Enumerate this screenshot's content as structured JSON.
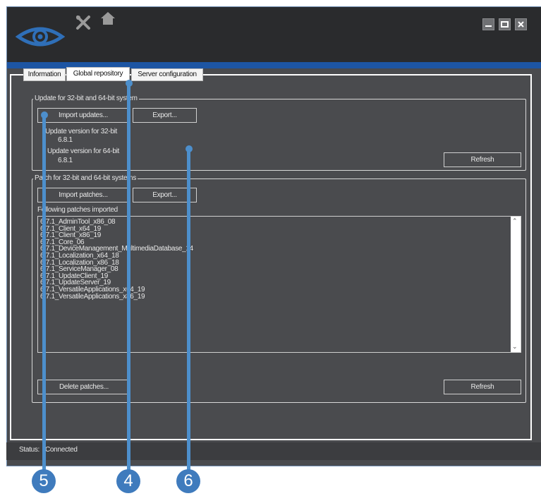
{
  "colors": {
    "accent": "#1d55a3",
    "callout": "#3f7bbd",
    "window_bg": "#4a4b4e",
    "titlebar": "#2a2b2d"
  },
  "titlebar": {
    "icons": [
      "eye-logo-icon",
      "tools-icon",
      "home-icon"
    ],
    "controls": [
      "minimize-icon",
      "maximize-icon",
      "close-icon"
    ]
  },
  "tabs": [
    {
      "label": "Information",
      "active": false
    },
    {
      "label": "Global repository",
      "active": true
    },
    {
      "label": "Server configuration",
      "active": false
    }
  ],
  "update_group": {
    "title": "Update for 32-bit and 64-bit system",
    "import_label": "Import updates...",
    "export_label": "Export...",
    "version32_label": "Update version for 32-bit",
    "version32_value": "6.8.1",
    "version64_label": "Update version for 64-bit",
    "version64_value": "6.8.1",
    "refresh_label": "Refresh"
  },
  "patch_group": {
    "title": "Patch for 32-bit and 64-bit systems",
    "import_label": "Import patches...",
    "export_label": "Export...",
    "list_label": "Following patches imported",
    "patches": [
      "6.7.1_AdminTool_x86_08",
      "6.7.1_Client_x64_19",
      "6.7.1_Client_x86_19",
      "6.7.1_Core_06",
      "6.7.1_DeviceManagement_MultimediaDatabase_14",
      "6.7.1_Localization_x64_18",
      "6.7.1_Localization_x86_18",
      "6.7.1_ServiceManager_08",
      "6.7.1_UpdateClient_19",
      "6.7.1_UpdateServer_19",
      "6.7.1_VersatileApplications_x64_19",
      "6.7.1_VersatileApplications_x86_19"
    ],
    "delete_label": "Delete patches...",
    "refresh_label": "Refresh"
  },
  "status": {
    "label": "Status:",
    "value": "Connected"
  },
  "callouts": [
    "5",
    "4",
    "6"
  ]
}
